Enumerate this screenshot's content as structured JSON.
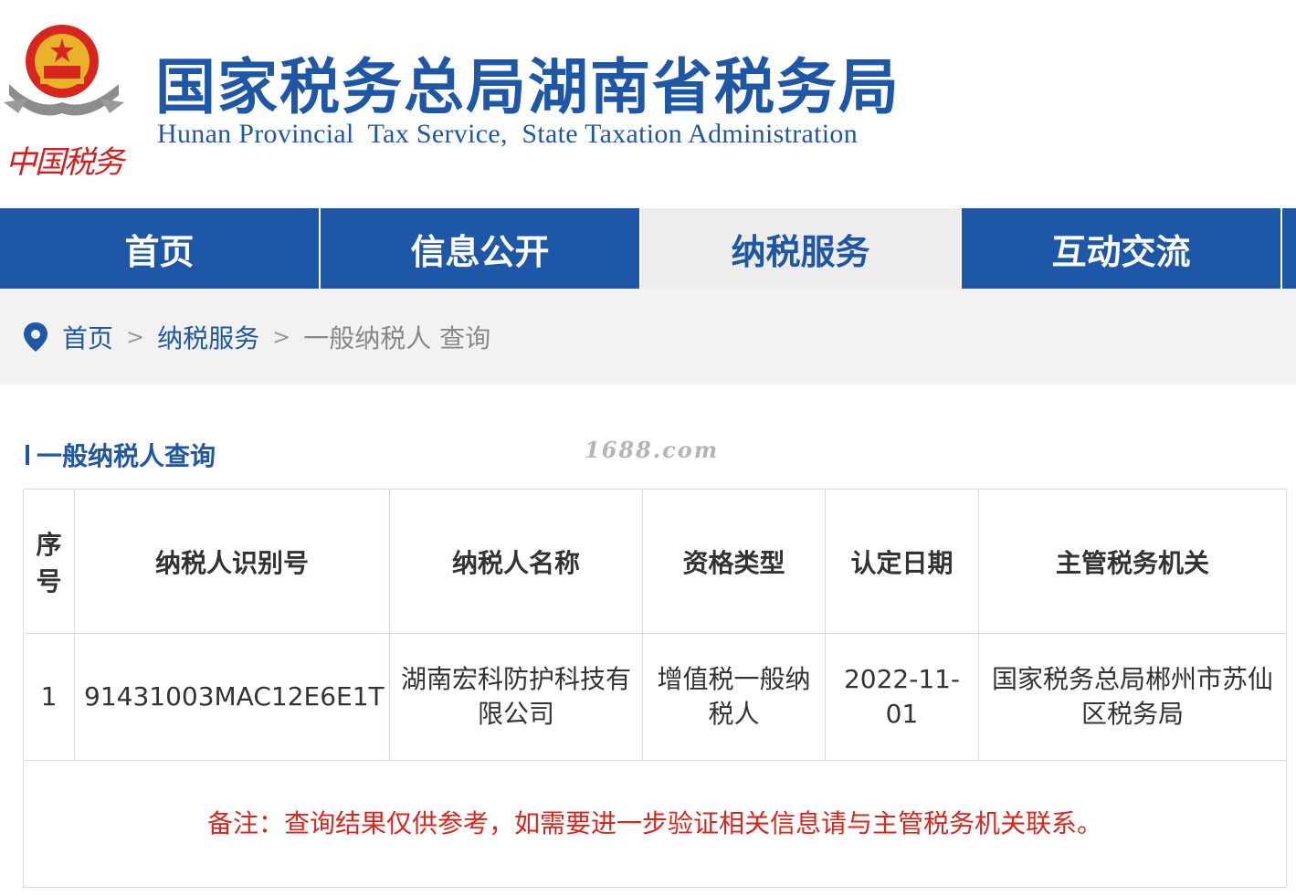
{
  "header": {
    "emblem_text": "中国税务",
    "title": "国家税务总局湖南省税务局",
    "subtitle": "Hunan Provincial  Tax Service,  State Taxation Administration"
  },
  "nav": {
    "items": [
      {
        "label": "首页"
      },
      {
        "label": "信息公开"
      },
      {
        "label": "纳税服务",
        "active": true
      },
      {
        "label": "互动交流"
      }
    ]
  },
  "breadcrumb": {
    "home": "首页",
    "level2": "纳税服务",
    "current": "一般纳税人 查询"
  },
  "section": {
    "title": "一般纳税人查询",
    "watermark": "1688.com"
  },
  "table": {
    "headers": [
      "序号",
      "纳税人识别号",
      "纳税人名称",
      "资格类型",
      "认定日期",
      "主管税务机关"
    ],
    "rows": [
      [
        "1",
        "91431003MAC12E6E1T",
        "湖南宏科防护科技有限公司",
        "增值税一般纳税人",
        "2022-11-01",
        "国家税务总局郴州市苏仙区税务局"
      ]
    ],
    "note": "备注：查询结果仅供参考，如需要进一步验证相关信息请与主管税务机关联系。"
  },
  "colors": {
    "brand_blue": "#1f57a8",
    "note_red": "#d8261f",
    "nav_active_bg": "#ededed"
  }
}
